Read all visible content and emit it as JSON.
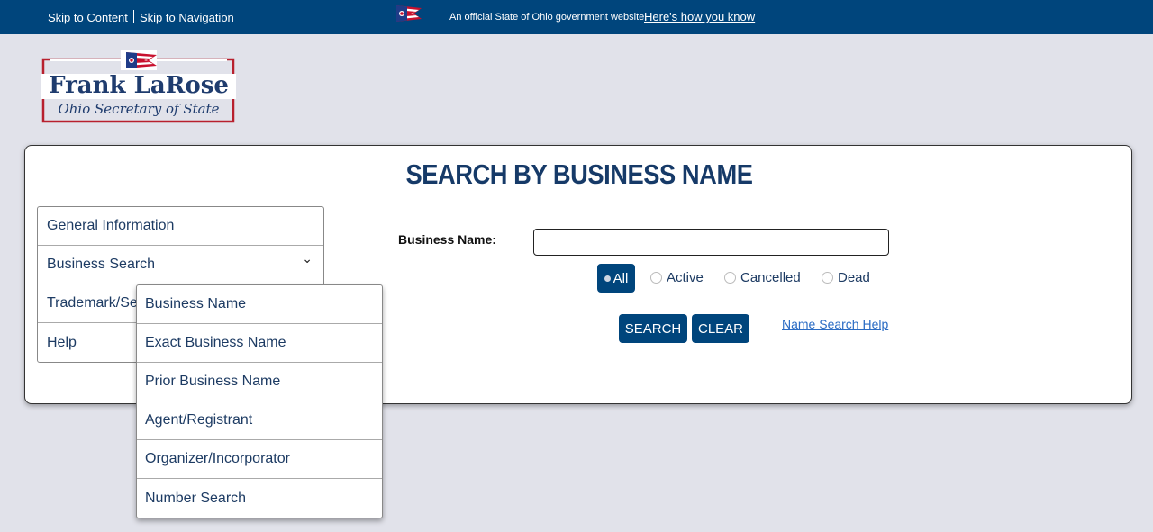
{
  "topbar": {
    "skip_content": "Skip to Content",
    "skip_navigation": "Skip to Navigation",
    "official_text": "An official State of Ohio government website.",
    "how_you_know": "Here's how you know"
  },
  "logo": {
    "name": "Frank LaRose",
    "subtitle": "Ohio Secretary of State"
  },
  "page": {
    "title": "SEARCH BY BUSINESS NAME"
  },
  "sidebar": {
    "items": [
      {
        "label": "General Information"
      },
      {
        "label": "Business Search"
      },
      {
        "label": "Trademark/Se"
      },
      {
        "label": "Help"
      }
    ]
  },
  "dropdown": {
    "items": [
      {
        "label": "Business Name"
      },
      {
        "label": "Exact Business Name"
      },
      {
        "label": "Prior Business Name"
      },
      {
        "label": "Agent/Registrant"
      },
      {
        "label": "Organizer/Incorporator"
      },
      {
        "label": "Number Search"
      }
    ]
  },
  "form": {
    "business_name_label": "Business Name:",
    "business_name_value": "",
    "status_options": [
      "All",
      "Active",
      "Cancelled",
      "Dead"
    ],
    "selected_status": "All",
    "search_label": "SEARCH",
    "clear_label": "CLEAR",
    "help_link": "Name Search Help"
  },
  "colors": {
    "brand_navy": "#00457c",
    "title_navy": "#163a68",
    "link_blue": "#2b6cc4",
    "logo_red": "#b8202e",
    "page_bg": "#e1e2ea"
  }
}
